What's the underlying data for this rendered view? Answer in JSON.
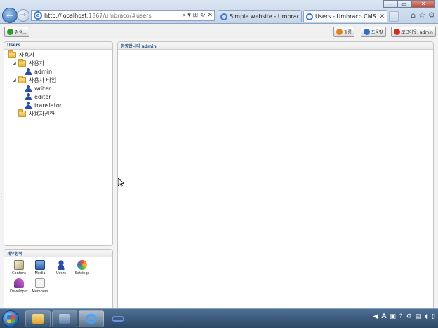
{
  "browser": {
    "address": {
      "host": "http://localhost",
      "rest": ":1867/umbraco/#users"
    },
    "address_controls": "⌕ ▾ ⊞ ↻ ✕",
    "tabs": [
      {
        "title": "Simple website - Umbraco C..."
      },
      {
        "title": "Users - Umbraco CMS - lo..."
      }
    ],
    "window_controls": {
      "minimize": "–",
      "maximize": "▭",
      "close": "✕"
    },
    "right_icons": [
      "home-icon",
      "star-icon",
      "gear-icon"
    ]
  },
  "toolbar": {
    "search_label": "검색...",
    "btn_a_label": "절름",
    "btn_b_label": "도움말",
    "logout_label": "로그아웃: admin"
  },
  "tree": {
    "header": "Users",
    "nodes": [
      {
        "label": "사용자"
      },
      {
        "label": "사용자"
      },
      {
        "label": "admin"
      },
      {
        "label": "사용자 타입"
      },
      {
        "label": "writer"
      },
      {
        "label": "editor"
      },
      {
        "label": "translator"
      },
      {
        "label": "사용자권한"
      }
    ]
  },
  "sections": {
    "header": "세부항목",
    "items": [
      {
        "label": "Content"
      },
      {
        "label": "Media"
      },
      {
        "label": "Users"
      },
      {
        "label": "Settings"
      },
      {
        "label": "Developer"
      },
      {
        "label": "Members"
      }
    ]
  },
  "main": {
    "header": "환영합니다 admin"
  },
  "taskbar": {
    "tray": {
      "lang": "A",
      "help": "?"
    }
  }
}
